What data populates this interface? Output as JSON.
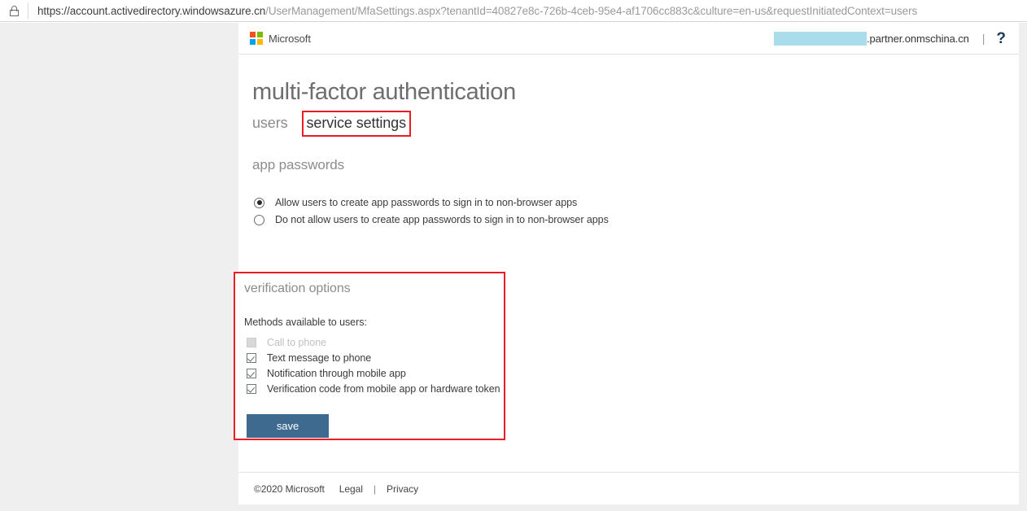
{
  "browser": {
    "lock_icon": "lock-icon",
    "url_secure_part": "https://account.activedirectory.windowsazure.cn",
    "url_path_part": "/UserManagement/MfaSettings.aspx?tenantId=40827e8c-726b-4ceb-95e4-af1706cc883c&culture=en-us&requestInitiatedContext=users",
    "url_full": "https://account.activedirectory.windowsazure.cn/UserManagement/MfaSettings.aspx?tenantId=40827e8c-726b-4ceb-95e4-af1706cc883c&culture=en-us&requestInitiatedContext=users"
  },
  "header": {
    "brand": "Microsoft",
    "logo_colors": [
      "#f25022",
      "#7fba00",
      "#00a4ef",
      "#ffb900"
    ],
    "account_redacted": true,
    "account_domain": ".partner.onmschina.cn",
    "divider": "|",
    "help_icon": "question-mark-icon",
    "help_label": "?"
  },
  "main": {
    "title": "multi-factor authentication",
    "tabs": [
      {
        "label": "users",
        "active": false,
        "highlighted": false
      },
      {
        "label": "service settings",
        "active": true,
        "highlighted": true
      }
    ],
    "app_passwords": {
      "section_title": "app passwords",
      "options": [
        {
          "label": "Allow users to create app passwords to sign in to non-browser apps",
          "selected": true
        },
        {
          "label": "Do not allow users to create app passwords to sign in to non-browser apps",
          "selected": false
        }
      ]
    },
    "verification_options": {
      "section_title": "verification options",
      "highlighted": true,
      "methods_label": "Methods available to users:",
      "methods": [
        {
          "label": "Call to phone",
          "checked": false,
          "disabled": true
        },
        {
          "label": "Text message to phone",
          "checked": true,
          "disabled": false
        },
        {
          "label": "Notification through mobile app",
          "checked": true,
          "disabled": false
        },
        {
          "label": "Verification code from mobile app or hardware token",
          "checked": true,
          "disabled": false
        }
      ],
      "save_label": "save"
    }
  },
  "footer": {
    "copyright": "©2020 Microsoft",
    "legal": "Legal",
    "separator": "|",
    "privacy": "Privacy"
  },
  "colors": {
    "annotation_red": "#ea1c24",
    "save_button": "#3f6a8f",
    "redaction": "#aadcec",
    "page_background": "#efefef",
    "panel_background": "#ffffff"
  }
}
